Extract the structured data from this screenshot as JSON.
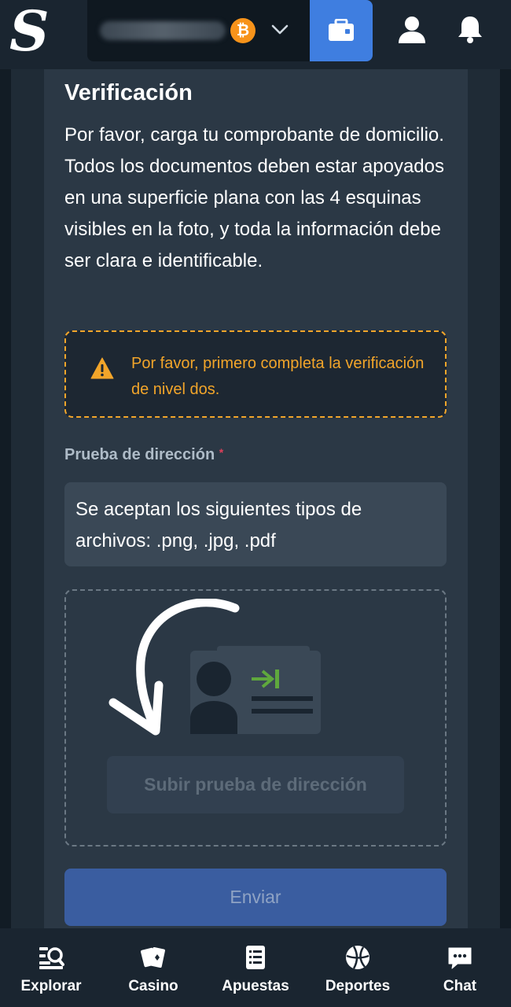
{
  "header": {
    "logo_text": "S",
    "crypto_symbol": "₿",
    "colors": {
      "wallet_button": "#3f7ee0",
      "bitcoin": "#f7931a"
    }
  },
  "verification": {
    "title": "Verificación",
    "description": "Por favor, carga tu comprobante de domicilio. Todos los documentos deben estar apoyados en una superficie plana con las 4 esquinas visibles en la foto, y toda la información debe ser clara e identificable.",
    "warning": "Por favor, primero completa la verificación de nivel dos.",
    "field_label": "Prueba de dirección",
    "required_mark": "*",
    "accepted_types": "Se aceptan los siguientes tipos de archivos: .png, .jpg, .pdf",
    "upload_button": "Subir prueba de dirección",
    "submit_button": "Enviar",
    "colors": {
      "warning": "#f2a52a",
      "required": "#e0405a",
      "submit": "#3a5da0"
    }
  },
  "bottom_nav": {
    "items": [
      {
        "label": "Explorar",
        "icon": "explore-icon"
      },
      {
        "label": "Casino",
        "icon": "casino-cards-icon"
      },
      {
        "label": "Apuestas",
        "icon": "bets-list-icon"
      },
      {
        "label": "Deportes",
        "icon": "basketball-icon"
      },
      {
        "label": "Chat",
        "icon": "chat-icon"
      }
    ]
  }
}
